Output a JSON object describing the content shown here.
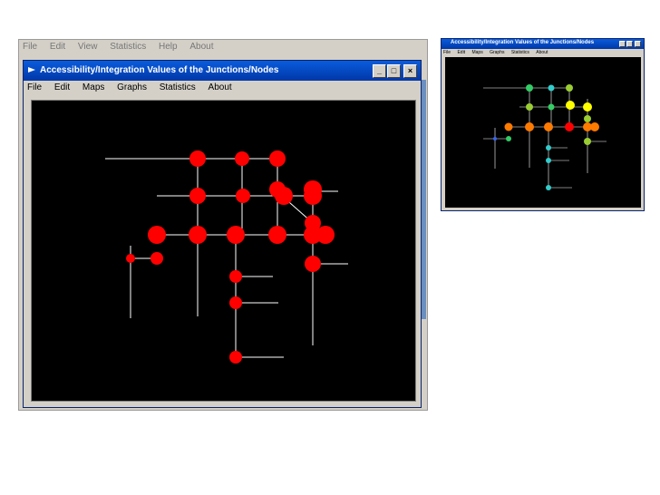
{
  "background_window": {
    "menu": [
      "File",
      "Edit",
      "View",
      "Statistics",
      "Help",
      "About"
    ]
  },
  "main_window": {
    "title": "Accessibility/Integration Values of the Junctions/Nodes",
    "menu": [
      "File",
      "Edit",
      "Maps",
      "Graphs",
      "Statistics",
      "About"
    ],
    "node_color": "#ff0000",
    "edge_color": "#ffffff",
    "canvas_bg": "#000000"
  },
  "small_window": {
    "title": "Accessibility/Integration Values of the Junctions/Nodes",
    "menu": [
      "File",
      "Edit",
      "Maps",
      "Graphs",
      "Statistics",
      "About"
    ],
    "color_scale": {
      "high": "#ff0000",
      "mid_high": "#ff7a00",
      "mid": "#ffff00",
      "mid_low": "#9acd32",
      "low": "#33cc66",
      "lowest": "#33cccc"
    }
  },
  "icons": {
    "window_icon": "app-icon",
    "minimize": "minimize-icon",
    "maximize": "maximize-icon",
    "close": "close-icon"
  }
}
